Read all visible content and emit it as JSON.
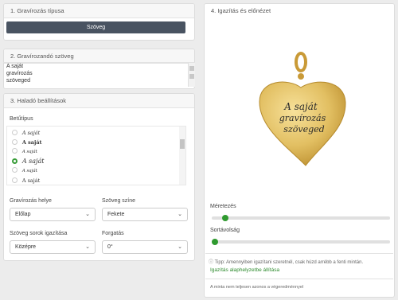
{
  "card1": {
    "title": "1. Gravírozás típusa",
    "button": "Szöveg"
  },
  "card2": {
    "title": "2. Gravírozandó szöveg",
    "lines": [
      "A saját",
      "gravírozás",
      "szöveged"
    ]
  },
  "card3": {
    "title": "3. Haladó beállítások",
    "font_label": "Betűtípus",
    "fonts": [
      "A saját",
      "A saját",
      "A saját",
      "A saját",
      "A saját",
      "A saját"
    ],
    "selected_font_index": 3,
    "placement_label": "Gravírozás helye",
    "placement_value": "Előlap",
    "color_label": "Szöveg színe",
    "color_value": "Fekete",
    "align_label": "Szöveg sorok igazítása",
    "align_value": "Középre",
    "rotation_label": "Forgatás",
    "rotation_value": "0°"
  },
  "card4": {
    "title": "4. Igazítás és előnézet",
    "engraving_lines": [
      "A saját",
      "gravírozás",
      "szöveged"
    ],
    "size_label": "Méretezés",
    "size_level": 0.06,
    "spacing_label": "Sortávolság",
    "spacing_level": 0.0,
    "tip": "Tipp: Amennyiben igazítani szeretnél, csak húzd arrébb a fenti mintán.",
    "reset_link": "Igazítás alaphelyzetbe állítása",
    "note": "A minta nem teljesen azonos a végeredménnyel"
  },
  "colors": {
    "accent": "#2f9a2f",
    "button": "#495361",
    "gold": "#e2bf62"
  }
}
